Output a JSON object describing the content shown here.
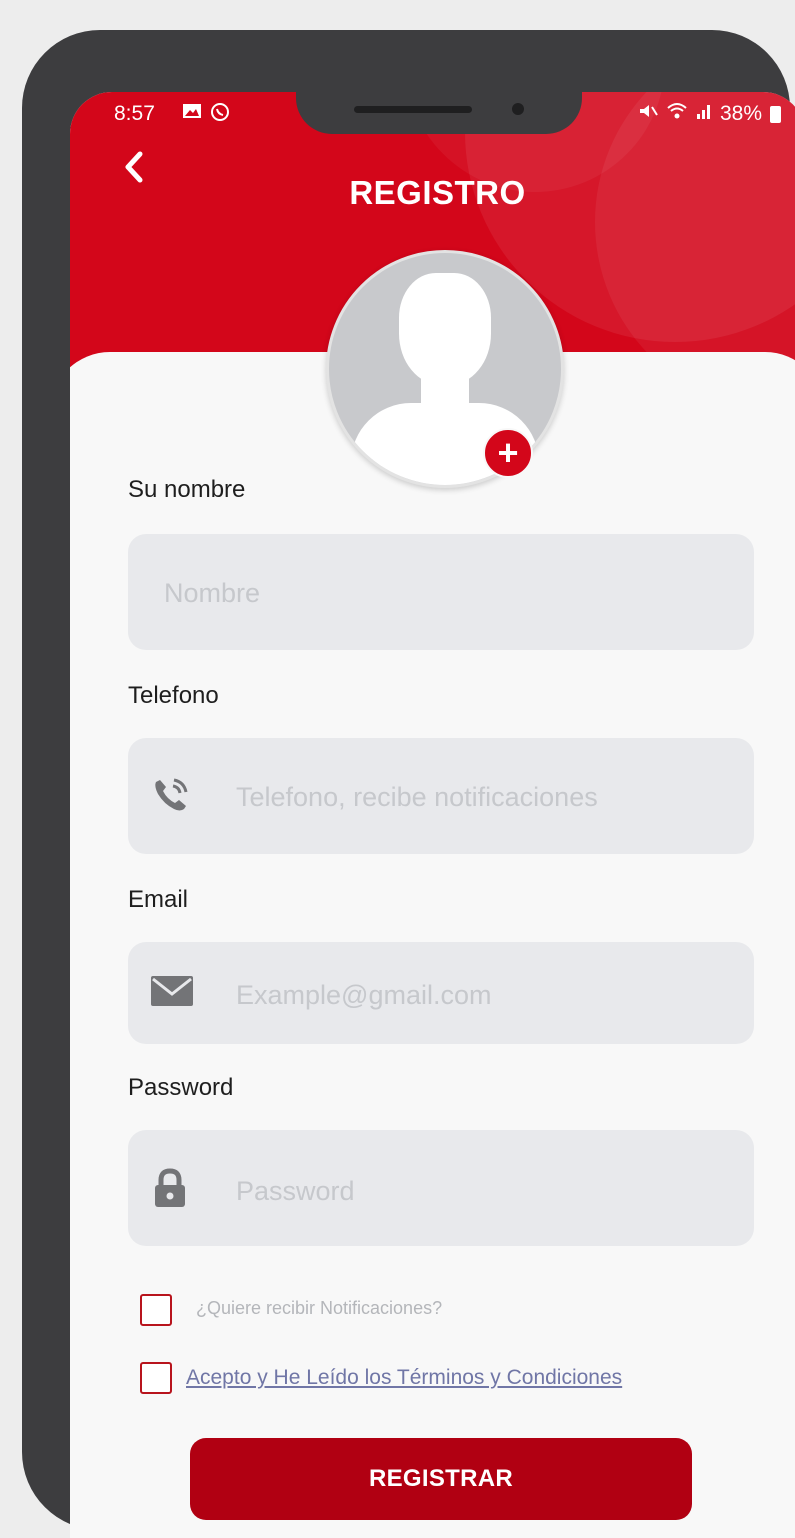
{
  "status_bar": {
    "time": "8:57",
    "left_icons": [
      "image-icon",
      "whatsapp-icon"
    ],
    "right_icons": [
      "mute-icon",
      "wifi-icon",
      "signal-icon"
    ],
    "battery": "38%"
  },
  "header": {
    "title": "REGISTRO",
    "back_icon": "chevron-left-icon",
    "color": "#d3061a"
  },
  "avatar": {
    "icon": "person-silhouette-icon",
    "add_icon": "plus-icon"
  },
  "form": {
    "name": {
      "label": "Su nombre",
      "placeholder": "Nombre"
    },
    "phone": {
      "label": "Telefono",
      "placeholder": "Telefono, recibe notificaciones",
      "icon": "phone-icon"
    },
    "email": {
      "label": "Email",
      "placeholder": "Example@gmail.com",
      "icon": "mail-icon"
    },
    "password": {
      "label": "Password",
      "placeholder": "Password",
      "icon": "lock-icon"
    },
    "notifications_checkbox": {
      "label": "¿Quiere recibir Notificaciones?",
      "checked": false
    },
    "terms_checkbox": {
      "label": "Acepto y He Leído los Términos y Condiciones",
      "checked": false
    }
  },
  "submit_button": {
    "label": "REGISTRAR",
    "color": "#b10012"
  }
}
